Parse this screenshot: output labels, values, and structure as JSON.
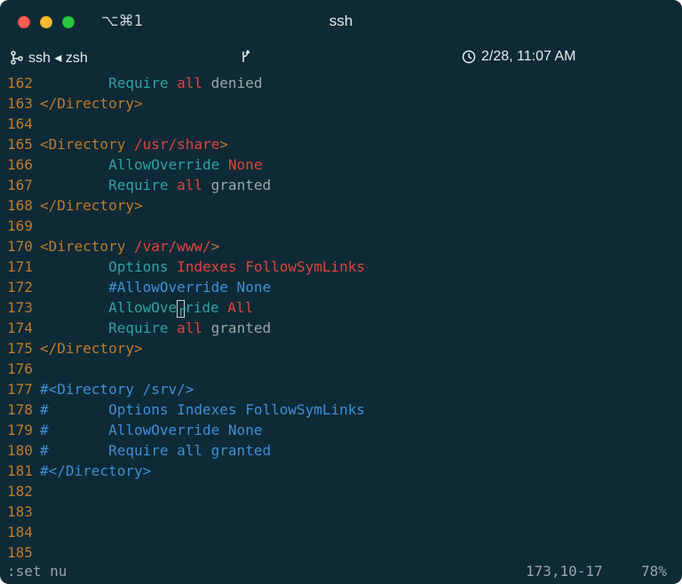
{
  "window": {
    "shortcut": "⌥⌘1",
    "title": "ssh"
  },
  "tabbar": {
    "session": "ssh ◂ zsh",
    "branch_icon": "branch-icon",
    "mid_icon": "git-branch-icon",
    "datetime": "2/28, 11:07 AM",
    "clock_icon": "clock-icon"
  },
  "colors": {
    "background": "#0d2a36",
    "line_number": "#c07a2a",
    "tag": "#c07a2a",
    "directive": "#2fa39a",
    "value": "#e0443e",
    "comment": "#3f8fd6",
    "text": "#9aa5a8"
  },
  "lines": [
    {
      "num": "162",
      "indent": "        ",
      "parts": [
        {
          "t": "Require ",
          "c": "dir"
        },
        {
          "t": "all",
          "c": "red"
        },
        {
          "t": " denied",
          "c": "text"
        }
      ]
    },
    {
      "num": "163",
      "indent": "",
      "parts": [
        {
          "t": "</Directory>",
          "c": "tag"
        }
      ]
    },
    {
      "num": "164",
      "indent": "",
      "parts": []
    },
    {
      "num": "165",
      "indent": "",
      "parts": [
        {
          "t": "<Directory ",
          "c": "tag"
        },
        {
          "t": "/usr/share",
          "c": "attr"
        },
        {
          "t": ">",
          "c": "tag"
        }
      ]
    },
    {
      "num": "166",
      "indent": "        ",
      "parts": [
        {
          "t": "AllowOverride ",
          "c": "dir"
        },
        {
          "t": "None",
          "c": "red"
        }
      ]
    },
    {
      "num": "167",
      "indent": "        ",
      "parts": [
        {
          "t": "Require ",
          "c": "dir"
        },
        {
          "t": "all",
          "c": "red"
        },
        {
          "t": " granted",
          "c": "text"
        }
      ]
    },
    {
      "num": "168",
      "indent": "",
      "parts": [
        {
          "t": "</Directory>",
          "c": "tag"
        }
      ]
    },
    {
      "num": "169",
      "indent": "",
      "parts": []
    },
    {
      "num": "170",
      "indent": "",
      "parts": [
        {
          "t": "<Directory ",
          "c": "tag"
        },
        {
          "t": "/var/www/",
          "c": "attr"
        },
        {
          "t": ">",
          "c": "tag"
        }
      ]
    },
    {
      "num": "171",
      "indent": "        ",
      "parts": [
        {
          "t": "Options ",
          "c": "dir"
        },
        {
          "t": "Indexes FollowSymLinks",
          "c": "red"
        }
      ]
    },
    {
      "num": "172",
      "indent": "        ",
      "parts": [
        {
          "t": "#AllowOverride None",
          "c": "comment"
        }
      ]
    },
    {
      "num": "173",
      "indent": "        ",
      "parts": [
        {
          "t": "AllowOve",
          "c": "dir"
        },
        {
          "t": "r",
          "c": "cursor"
        },
        {
          "t": "ride ",
          "c": "dir"
        },
        {
          "t": "All",
          "c": "red"
        }
      ]
    },
    {
      "num": "174",
      "indent": "        ",
      "parts": [
        {
          "t": "Require ",
          "c": "dir"
        },
        {
          "t": "all",
          "c": "red"
        },
        {
          "t": " granted",
          "c": "text"
        }
      ]
    },
    {
      "num": "175",
      "indent": "",
      "parts": [
        {
          "t": "</Directory>",
          "c": "tag"
        }
      ]
    },
    {
      "num": "176",
      "indent": "",
      "parts": []
    },
    {
      "num": "177",
      "indent": "",
      "parts": [
        {
          "t": "#<Directory /srv/>",
          "c": "comment"
        }
      ]
    },
    {
      "num": "178",
      "indent": "",
      "parts": [
        {
          "t": "#       Options Indexes FollowSymLinks",
          "c": "comment"
        }
      ]
    },
    {
      "num": "179",
      "indent": "",
      "parts": [
        {
          "t": "#       AllowOverride None",
          "c": "comment"
        }
      ]
    },
    {
      "num": "180",
      "indent": "",
      "parts": [
        {
          "t": "#       Require all granted",
          "c": "comment"
        }
      ]
    },
    {
      "num": "181",
      "indent": "",
      "parts": [
        {
          "t": "#</Directory>",
          "c": "comment"
        }
      ]
    },
    {
      "num": "182",
      "indent": "",
      "parts": []
    },
    {
      "num": "183",
      "indent": "",
      "parts": []
    },
    {
      "num": "184",
      "indent": "",
      "parts": []
    },
    {
      "num": "185",
      "indent": "",
      "parts": []
    }
  ],
  "statusbar": {
    "command": ":set nu",
    "position": "173,10-17",
    "percent": "78%"
  }
}
